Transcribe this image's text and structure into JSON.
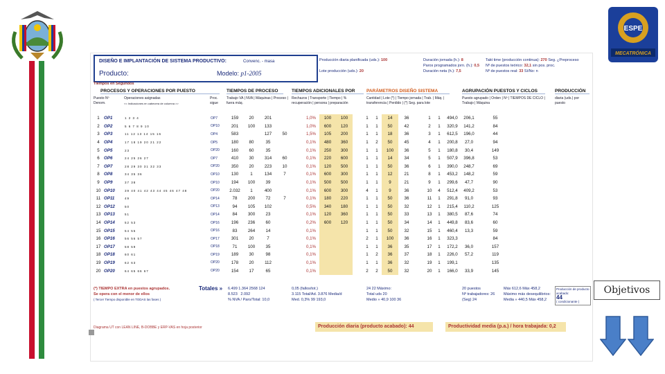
{
  "sheet": {
    "title": "DISEÑO E IMPLANTACIÓN DE SISTEMA PRODUCTIVO:",
    "case": "Convenc. - masa",
    "product_label": "Producto:",
    "model_label": "Modelo:",
    "model_value": "p1-2005",
    "info_left": [
      {
        "label": "Producción diaria planificada (uds.):",
        "value": "100"
      },
      {
        "label": "Lote producción (uds.):",
        "value": "20"
      }
    ],
    "info_mid": [
      {
        "label": "Duración jornada (h.):",
        "value": "8"
      },
      {
        "label": "Paros programados jorn. (h.):",
        "value": "0,5"
      },
      {
        "label": "Duración neta (h.):",
        "value": "7,5"
      }
    ],
    "info_right": [
      {
        "label": "Takt time (producción continua):",
        "value": "270",
        "unit": "Seg. ¿Preproceso"
      },
      {
        "label": "Nº de puestos teórico:",
        "value": "32,1",
        "unit": "sin pos. proc."
      },
      {
        "label": "Nº de puestos real:",
        "value": "33",
        "unit": "Sí/No: n"
      }
    ],
    "tiempos_label": "Tiempos en Segundos",
    "sections": {
      "procesos": "PROCESOS Y OPERACIONES POR PUESTO",
      "tiempos_proceso": "TIEMPOS DE PROCESO",
      "tiempos_adicionales": "TIEMPOS ADICIONALES POR",
      "parametros": "PARÁMETROS DISEÑO SISTEMA",
      "agrupacion": "AGRUPACIÓN PUESTOS Y CICLOS",
      "produccion": "PRODUCCIÓN"
    },
    "col_headers": {
      "puesto": "Puesto Nº Denom.",
      "operaciones": "Operaciones asignadas",
      "ops_hint": "<< Indicaciones en cabecera de columna >>",
      "proc": "Proc. sigue",
      "tp": "Trabajo VA | NVA | Máquinas | Proceso | fuera máq.",
      "ta": "Rechazos | Transporte | Tiempo | % recuperación | persona | preparación",
      "par": "Cantidad | Lote (*) | Tiempo jornada | Trab. | Máq. | transferencia | Perdido | (*) Seg. para lote",
      "agr": "Puesto agrupado | Orden | Nº | TIEMPOS DE CICLO | Trabajo | Máquina",
      "prod": "diaria (uds.) por puesto"
    },
    "rows": [
      {
        "n": "1",
        "op": "OP1",
        "seq": "1 2 3 4",
        "pos": "OP7",
        "va": "159",
        "nva": "20",
        "maq": "201",
        "pr": "",
        "r": "1,0%",
        "tr": "100",
        "tp": "100",
        "q": "1",
        "m": "1",
        "l": "14",
        "j": "36",
        "g": "1",
        "o": "1",
        "t": "494,0",
        "mq": "206,1",
        "p": "55"
      },
      {
        "n": "2",
        "op": "OP2",
        "seq": "5 6 7 8 9 10",
        "pos": "OP10",
        "va": "201",
        "nva": "100",
        "maq": "133",
        "pr": "",
        "r": "1,0%",
        "tr": "600",
        "tp": "120",
        "q": "1",
        "m": "1",
        "l": "50",
        "j": "42",
        "g": "2",
        "o": "1",
        "t": "320,9",
        "mq": "141,2",
        "p": "84"
      },
      {
        "n": "3",
        "op": "OP3",
        "seq": "11 12 13 14 15 16",
        "pos": "OP4",
        "va": "583",
        "nva": "",
        "maq": "127",
        "pr": "50",
        "r": "1,5%",
        "tr": "105",
        "tp": "200",
        "q": "1",
        "m": "1",
        "l": "18",
        "j": "36",
        "g": "3",
        "o": "1",
        "t": "612,5",
        "mq": "196,0",
        "p": "44"
      },
      {
        "n": "4",
        "op": "OP4",
        "seq": "17 18 19 20 21 22",
        "pos": "OP5",
        "va": "180",
        "nva": "80",
        "maq": "35",
        "pr": "",
        "r": "0,1%",
        "tr": "480",
        "tp": "360",
        "q": "1",
        "m": "2",
        "l": "50",
        "j": "45",
        "g": "4",
        "o": "1",
        "t": "200,8",
        "mq": "27,0",
        "p": "94"
      },
      {
        "n": "5",
        "op": "OP5",
        "seq": "23",
        "pos": "OP20",
        "va": "160",
        "nva": "60",
        "maq": "35",
        "pr": "",
        "r": "0,1%",
        "tr": "250",
        "tp": "300",
        "q": "1",
        "m": "1",
        "l": "100",
        "j": "36",
        "g": "5",
        "o": "1",
        "t": "180,8",
        "mq": "30,4",
        "p": "149"
      },
      {
        "n": "6",
        "op": "OP6",
        "seq": "24 25 26 27",
        "pos": "OP7",
        "va": "410",
        "nva": "30",
        "maq": "314",
        "pr": "60",
        "r": "0,1%",
        "tr": "220",
        "tp": "600",
        "q": "1",
        "m": "1",
        "l": "14",
        "j": "34",
        "g": "5",
        "o": "1",
        "t": "507,9",
        "mq": "396,8",
        "p": "53"
      },
      {
        "n": "7",
        "op": "OP7",
        "seq": "28 29 30 31 32 33",
        "pos": "OP20",
        "va": "350",
        "nva": "20",
        "maq": "223",
        "pr": "10",
        "r": "0,1%",
        "tr": "120",
        "tp": "500",
        "q": "1",
        "m": "1",
        "l": "50",
        "j": "36",
        "g": "6",
        "o": "1",
        "t": "390,0",
        "mq": "248,7",
        "p": "69"
      },
      {
        "n": "8",
        "op": "OP8",
        "seq": "34 35 36",
        "pos": "OP10",
        "va": "130",
        "nva": "1",
        "maq": "134",
        "pr": "7",
        "r": "0,1%",
        "tr": "600",
        "tp": "300",
        "q": "1",
        "m": "1",
        "l": "12",
        "j": "21",
        "g": "8",
        "o": "1",
        "t": "453,2",
        "mq": "148,2",
        "p": "59"
      },
      {
        "n": "9",
        "op": "OP9",
        "seq": "37 38",
        "pos": "OP10",
        "va": "194",
        "nva": "100",
        "maq": "39",
        "pr": "",
        "r": "0,1%",
        "tr": "500",
        "tp": "500",
        "q": "1",
        "m": "1",
        "l": "9",
        "j": "21",
        "g": "9",
        "o": "1",
        "t": "299,6",
        "mq": "47,7",
        "p": "90"
      },
      {
        "n": "10",
        "op": "OP10",
        "seq": "39 40 41 42 43 44 45 46 47 48",
        "pos": "OP20",
        "va": "2.032",
        "nva": "1",
        "maq": "400",
        "pr": "",
        "r": "0,1%",
        "tr": "600",
        "tp": "300",
        "q": "4",
        "m": "1",
        "l": "9",
        "j": "36",
        "g": "10",
        "o": "4",
        "t": "512,4",
        "mq": "409,2",
        "p": "53"
      },
      {
        "n": "11",
        "op": "OP11",
        "seq": "49",
        "pos": "OP14",
        "va": "78",
        "nva": "200",
        "maq": "72",
        "pr": "7",
        "r": "0,1%",
        "tr": "180",
        "tp": "220",
        "q": "1",
        "m": "1",
        "l": "50",
        "j": "36",
        "g": "11",
        "o": "1",
        "t": "291,8",
        "mq": "91,0",
        "p": "93"
      },
      {
        "n": "12",
        "op": "OP12",
        "seq": "50",
        "pos": "OP13",
        "va": "94",
        "nva": "105",
        "maq": "102",
        "pr": "",
        "r": "0,5%",
        "tr": "340",
        "tp": "180",
        "q": "1",
        "m": "1",
        "l": "50",
        "j": "32",
        "g": "12",
        "o": "1",
        "t": "215,4",
        "mq": "110,2",
        "p": "125"
      },
      {
        "n": "13",
        "op": "OP13",
        "seq": "51",
        "pos": "OP14",
        "va": "84",
        "nva": "300",
        "maq": "23",
        "pr": "",
        "r": "0,1%",
        "tr": "120",
        "tp": "360",
        "q": "1",
        "m": "1",
        "l": "50",
        "j": "33",
        "g": "13",
        "o": "1",
        "t": "380,5",
        "mq": "87,6",
        "p": "74"
      },
      {
        "n": "14",
        "op": "OP14",
        "seq": "52 53",
        "pos": "OP16",
        "va": "196",
        "nva": "236",
        "maq": "60",
        "pr": "",
        "r": "0,2%",
        "tr": "600",
        "tp": "120",
        "q": "1",
        "m": "1",
        "l": "50",
        "j": "34",
        "g": "14",
        "o": "1",
        "t": "449,8",
        "mq": "83,6",
        "p": "60"
      },
      {
        "n": "15",
        "op": "OP15",
        "seq": "54 55",
        "pos": "OP16",
        "va": "83",
        "nva": "264",
        "maq": "14",
        "pr": "",
        "r": "0,1%",
        "tr": "",
        "tp": "",
        "q": "1",
        "m": "1",
        "l": "50",
        "j": "32",
        "g": "15",
        "o": "1",
        "t": "460,4",
        "mq": "13,3",
        "p": "59"
      },
      {
        "n": "16",
        "op": "OP16",
        "seq": "56 56 57",
        "pos": "OP17",
        "va": "301",
        "nva": "20",
        "maq": "7",
        "pr": "",
        "r": "0,1%",
        "tr": "",
        "tp": "",
        "q": "2",
        "m": "1",
        "l": "100",
        "j": "36",
        "g": "16",
        "o": "1",
        "t": "323,3",
        "mq": "",
        "p": "84"
      },
      {
        "n": "17",
        "op": "OP17",
        "seq": "58 59",
        "pos": "OP18",
        "va": "71",
        "nva": "100",
        "maq": "35",
        "pr": "",
        "r": "0,1%",
        "tr": "",
        "tp": "",
        "q": "1",
        "m": "1",
        "l": "36",
        "j": "35",
        "g": "17",
        "o": "1",
        "t": "172,2",
        "mq": "36,0",
        "p": "157"
      },
      {
        "n": "18",
        "op": "OP18",
        "seq": "60 61",
        "pos": "OP19",
        "va": "189",
        "nva": "30",
        "maq": "98",
        "pr": "",
        "r": "0,1%",
        "tr": "",
        "tp": "",
        "q": "1",
        "m": "2",
        "l": "36",
        "j": "37",
        "g": "18",
        "o": "1",
        "t": "226,0",
        "mq": "57,2",
        "p": "119"
      },
      {
        "n": "19",
        "op": "OP19",
        "seq": "62 63",
        "pos": "OP20",
        "va": "178",
        "nva": "20",
        "maq": "112",
        "pr": "",
        "r": "0,1%",
        "tr": "",
        "tp": "",
        "q": "1",
        "m": "1",
        "l": "36",
        "j": "32",
        "g": "19",
        "o": "1",
        "t": "199,1",
        "mq": "",
        "p": "135"
      },
      {
        "n": "20",
        "op": "OP20",
        "seq": "64 65 66 67",
        "pos": "OP20",
        "va": "154",
        "nva": "17",
        "maq": "65",
        "pr": "",
        "r": "0,1%",
        "tr": "",
        "tp": "",
        "q": "2",
        "m": "2",
        "l": "50",
        "j": "32",
        "g": "20",
        "o": "1",
        "t": "166,0",
        "mq": "33,9",
        "p": "145"
      }
    ],
    "footer": {
      "extra_line1": "(*) TIEMPO EXTRA en puestos agrupados.",
      "extra_line2": "Se opera con el menor de ellos",
      "extra_line3": "( Tercer Tiempo disponible en TODAS las fases )",
      "totales_label": "Totales »",
      "totals1": [
        "6.499",
        "1.364",
        "2568",
        "124"
      ],
      "totals2": [
        "8.523",
        "2.092"
      ],
      "pct_line": "% NVA / Paro/Total: 10,0",
      "fallos": "0,05 (fallos/tot.)",
      "total_tr": "3.115 Total/Ad.",
      "medial": "3.876 Media/d",
      "med": "Med. 0,3%  99  193,0",
      "maximo": "24  22  Máximo:",
      "total_uds": "Total uds 20",
      "medio": "Medio » 40,9   100  36",
      "puestos": "20 puestos",
      "trab": "Nº trabajadores: 26",
      "maq_d": "(Seg) 24",
      "maxmin": "Máx 612,6  Máx 458,2",
      "minmax": "Máximo más desequilibrios:",
      "media_line": "Media » 440,5  Máx 458,2",
      "prod_cap": "Producción de producto acabado:",
      "prod_val": "44",
      "prod_cond": "( condicionante )",
      "diagram_note": "Diagrama UT con LEAN LINE, B-DOBBE y ERP-VAS en hoja posterior",
      "prod_diaria_label": "Producción diaria (producto acabado):",
      "prod_diaria_value": "44",
      "productividad_label": "Productividad media (p.a.) / hora trabajada:",
      "productividad_value": "0,2"
    }
  },
  "objetivos_button": "Objetivos",
  "colors": {
    "blue_header": "#1f3f8f",
    "highlight": "#f5e4aa",
    "stripe_red": "#c8102e",
    "stripe_green": "#2e8b3e"
  }
}
